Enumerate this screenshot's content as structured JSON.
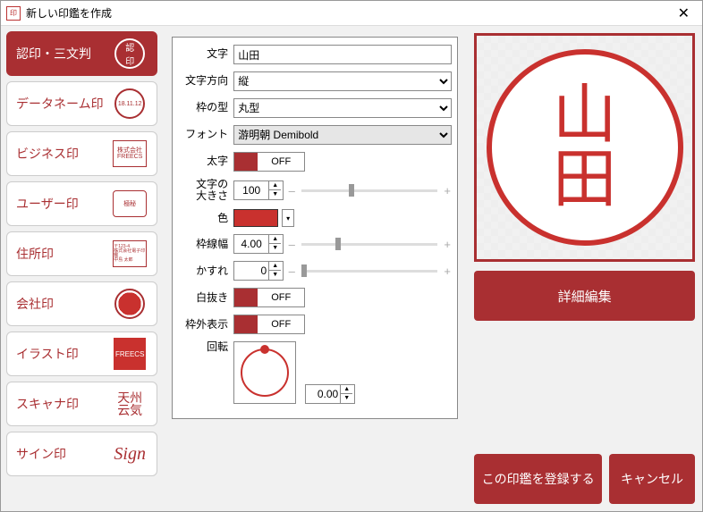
{
  "window": {
    "title": "新しい印鑑を作成"
  },
  "sidebar": {
    "items": [
      {
        "label": "認印・三文判",
        "icon": "認印"
      },
      {
        "label": "データネーム印",
        "icon": "○"
      },
      {
        "label": "ビジネス印",
        "icon": "FREECS"
      },
      {
        "label": "ユーザー印",
        "icon": "極秘"
      },
      {
        "label": "住所印",
        "icon": "addr"
      },
      {
        "label": "会社印",
        "icon": "seal"
      },
      {
        "label": "イラスト印",
        "icon": "FREECS"
      },
      {
        "label": "スキャナ印",
        "icon": "州"
      },
      {
        "label": "サイン印",
        "icon": "Sign"
      }
    ]
  },
  "form": {
    "labels": {
      "text": "文字",
      "direction": "文字方向",
      "frame": "枠の型",
      "font": "フォント",
      "bold": "太字",
      "size": "文字の\n大きさ",
      "color": "色",
      "lineWidth": "枠線幅",
      "blur": "かすれ",
      "whiteout": "白抜き",
      "outside": "枠外表示",
      "rotate": "回転"
    },
    "values": {
      "text": "山田",
      "direction": "縦",
      "frame": "丸型",
      "font": "游明朝 Demibold",
      "bold": "OFF",
      "size": "100",
      "color": "#c9312e",
      "lineWidth": "4.00",
      "blur": "0",
      "whiteout": "OFF",
      "outside": "OFF",
      "rotate": "0.00"
    }
  },
  "preview": {
    "char1": "山",
    "char2": "田",
    "detailBtn": "詳細編集",
    "registerBtn": "この印鑑を登録する",
    "cancelBtn": "キャンセル"
  }
}
